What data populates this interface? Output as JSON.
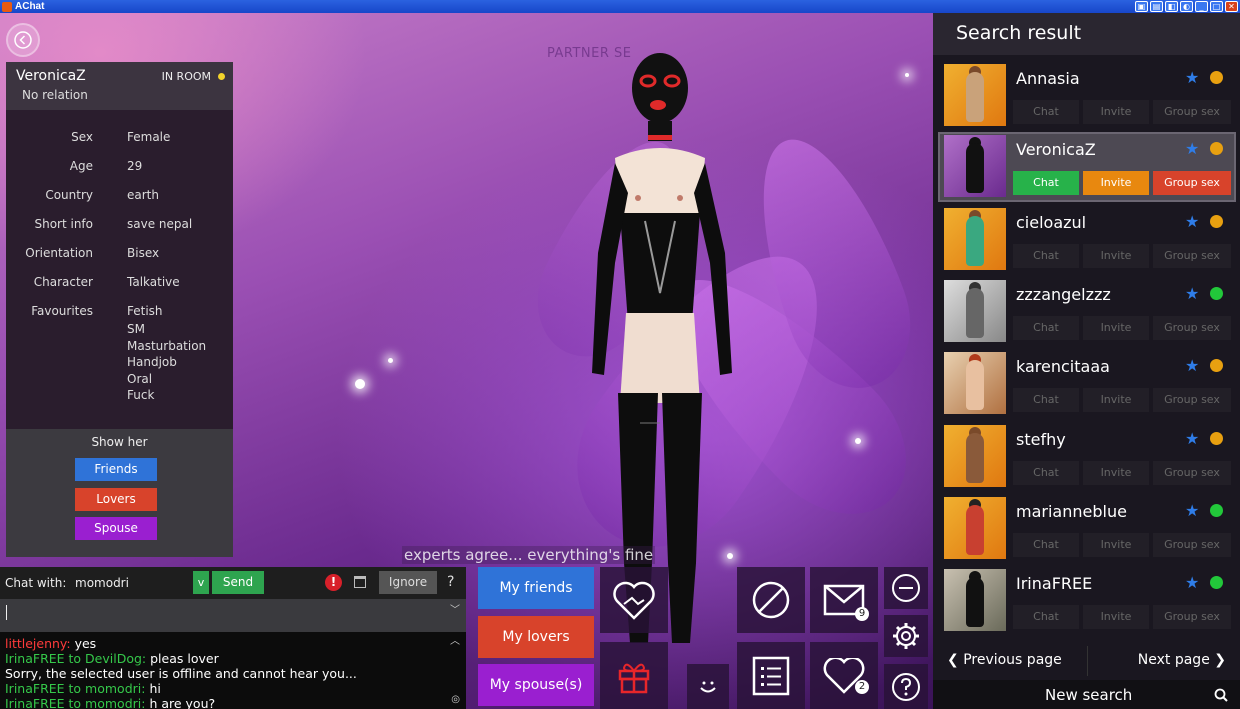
{
  "window": {
    "title": "AChat"
  },
  "scene": {
    "watermark": "PARTNER SE",
    "caption": "experts agree... everything's fine"
  },
  "profile": {
    "name": "VeronicaZ",
    "relation": "No relation",
    "status": "IN ROOM",
    "fields": [
      {
        "label": "Sex",
        "value": "Female"
      },
      {
        "label": "Age",
        "value": "29"
      },
      {
        "label": "Country",
        "value": "earth"
      },
      {
        "label": "Short info",
        "value": "save nepal"
      },
      {
        "label": "Orientation",
        "value": "Bisex"
      },
      {
        "label": "Character",
        "value": "Talkative"
      },
      {
        "label": "Favourites",
        "value": "Fetish"
      }
    ],
    "favourites_more": [
      "SM",
      "Masturbation",
      "Handjob",
      "Oral",
      "Fuck"
    ],
    "show_her": {
      "title": "Show her",
      "friends": "Friends",
      "lovers": "Lovers",
      "spouse": "Spouse"
    }
  },
  "chat": {
    "with_label": "Chat with:",
    "nick": "momodri",
    "v_label": "v",
    "send": "Send",
    "alert": "!",
    "ignore": "Ignore",
    "help": "?",
    "log": [
      {
        "who": "littlejenny:",
        "text": " yes",
        "color": "#ff3b3b"
      },
      {
        "who": "IrinaFREE to DevilDog:",
        "text": " pleas lover",
        "color": "#35c84a"
      },
      {
        "who": "",
        "text": "Sorry, the selected user is offline and cannot hear you...",
        "color": "#ffffff"
      },
      {
        "who": "IrinaFREE to momodri:",
        "text": " hi",
        "color": "#35c84a"
      },
      {
        "who": "IrinaFREE to momodri:",
        "text": " h are you?",
        "color": "#35c84a"
      }
    ]
  },
  "relations_buttons": {
    "friends": "My friends",
    "lovers": "My lovers",
    "spouses": "My spouse(s)"
  },
  "badges": {
    "mail": "9",
    "heart": "2"
  },
  "colors": {
    "blue": "#2f73d8",
    "red": "#d8432b",
    "purple": "#9a1fd0",
    "green": "#27b24a",
    "orange": "#e8880f"
  },
  "search": {
    "title": "Search result",
    "action_chat": "Chat",
    "action_invite": "Invite",
    "action_group": "Group sex",
    "results": [
      {
        "name": "Annasia",
        "status": "#e8a010"
      },
      {
        "name": "VeronicaZ",
        "status": "#e8a010"
      },
      {
        "name": "cieloazul",
        "status": "#e8a010"
      },
      {
        "name": "zzzangelzzz",
        "status": "#22c83a"
      },
      {
        "name": "karencitaaa",
        "status": "#e8a010"
      },
      {
        "name": "stefhy",
        "status": "#e8a010"
      },
      {
        "name": "marianneblue",
        "status": "#22c83a"
      },
      {
        "name": "IrinaFREE",
        "status": "#22c83a"
      }
    ],
    "prev": "Previous page",
    "next": "Next page",
    "new_search": "New search"
  }
}
